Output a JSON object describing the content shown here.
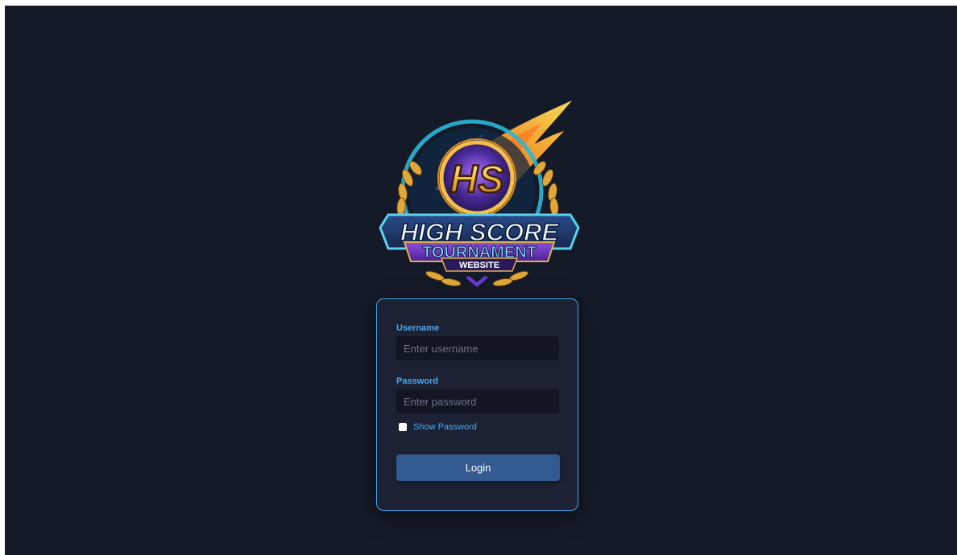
{
  "logo": {
    "monogram": "HS",
    "line1": "HIGH SCORE",
    "line2": "TOURNAMENT",
    "line3": "WEBSITE"
  },
  "login_form": {
    "username": {
      "label": "Username",
      "placeholder": "Enter username",
      "value": ""
    },
    "password": {
      "label": "Password",
      "placeholder": "Enter password",
      "value": ""
    },
    "show_password": {
      "label": "Show Password",
      "checked": false
    },
    "submit_label": "Login"
  },
  "colors": {
    "page_background": "#151a29",
    "card_background": "#1c2233",
    "card_border": "#4aa3e8",
    "label_accent": "#4aa8f0",
    "input_background": "#121623",
    "button_background": "#345a92"
  }
}
